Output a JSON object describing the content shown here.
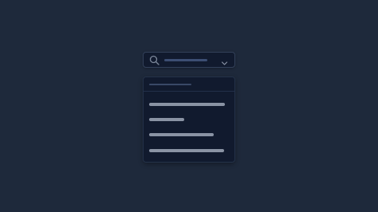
{
  "combobox": {
    "search_icon": "search-icon",
    "chevron_icon": "chevron-down-icon",
    "placeholder_text": ""
  },
  "dropdown": {
    "header_text": "",
    "options": [
      {
        "label": ""
      },
      {
        "label": ""
      },
      {
        "label": ""
      },
      {
        "label": ""
      }
    ]
  },
  "colors": {
    "background": "#1e293b",
    "surface": "#111a2e",
    "border": "#33415a",
    "text_placeholder": "#8a93a4",
    "accent_bar": "#3c4e73"
  }
}
